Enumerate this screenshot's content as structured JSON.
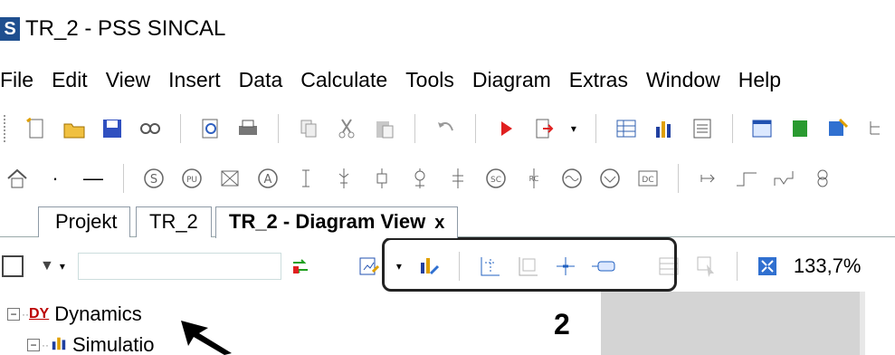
{
  "window": {
    "title": "TR_2 - PSS SINCAL",
    "logo_letter": "S"
  },
  "menu": [
    "File",
    "Edit",
    "View",
    "Insert",
    "Data",
    "Calculate",
    "Tools",
    "Diagram",
    "Extras",
    "Window",
    "Help"
  ],
  "toolbar1_icons": [
    "new-file-icon",
    "open-folder-icon",
    "save-icon",
    "find-icon",
    "print-preview-icon",
    "print-icon",
    "copy-icon",
    "cut-icon",
    "paste-icon",
    "undo-icon",
    "run-icon",
    "export-icon",
    "table-icon",
    "chart-icon",
    "calculator-icon",
    "window-icon",
    "green-icon",
    "properties-icon",
    "hierarchy-icon"
  ],
  "toolbar2_icons": [
    "home-icon",
    "dot-icon",
    "line-icon",
    "synchronous-machine-icon",
    "pu-icon",
    "transformer-icon",
    "ammeter-icon",
    "element1-icon",
    "element2-icon",
    "element3-icon",
    "element4-icon",
    "sc-icon",
    "rc-icon",
    "wave-icon",
    "check-icon",
    "dc-icon",
    "arrow-icon",
    "step-icon",
    "rv-icon",
    "coil-icon"
  ],
  "tabs": [
    {
      "label": "Projekt"
    },
    {
      "label": "TR_2"
    },
    {
      "label": "TR_2 - Diagram View",
      "close": "x"
    }
  ],
  "subbar": {
    "filter_symbol": "▼",
    "filter_value": "",
    "zoom": "133,7%"
  },
  "tree": [
    {
      "expander": "−",
      "icon": "DY",
      "label": "Dynamics"
    },
    {
      "expander": "−",
      "icon": "chart",
      "label": "Simulatio"
    }
  ],
  "annotation": {
    "number": "2"
  }
}
